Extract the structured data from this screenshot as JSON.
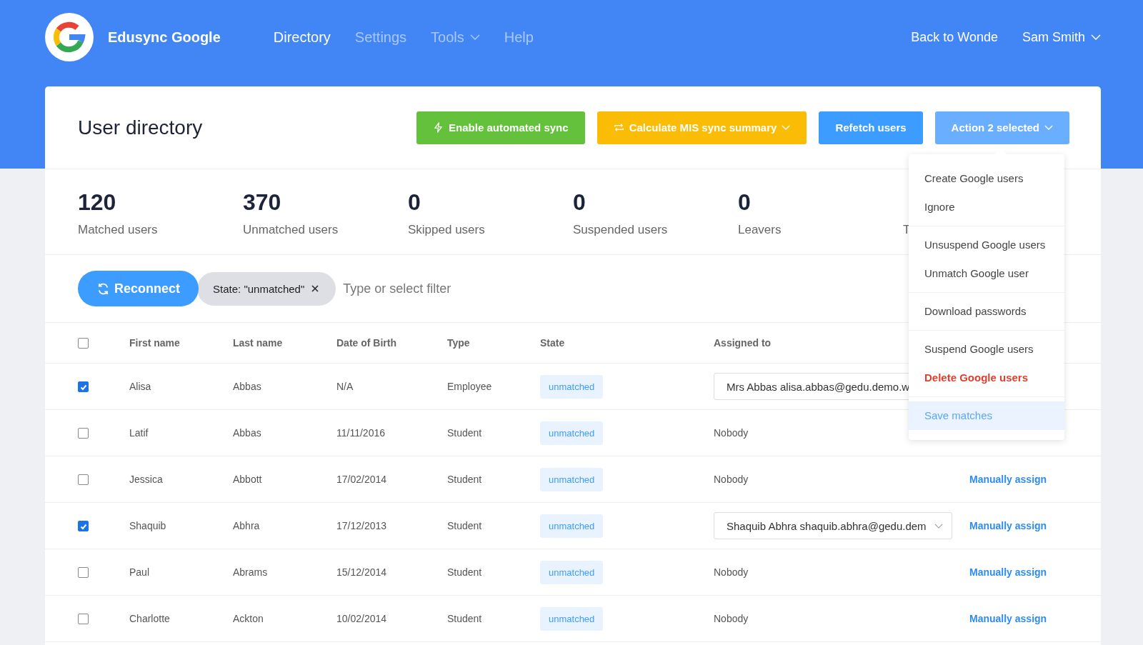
{
  "app": {
    "name": "Edusync Google"
  },
  "nav": [
    {
      "label": "Directory",
      "selected": true,
      "has_menu": false
    },
    {
      "label": "Settings",
      "selected": false,
      "has_menu": false
    },
    {
      "label": "Tools",
      "selected": false,
      "has_menu": true
    },
    {
      "label": "Help",
      "selected": false,
      "has_menu": false
    }
  ],
  "header_links": [
    {
      "label": "Back to Wonde",
      "has_menu": false
    },
    {
      "label": "Sam Smith",
      "has_menu": true
    }
  ],
  "page_title": "User directory",
  "actions": [
    {
      "label": "Enable automated sync",
      "kind": "green",
      "has_menu": false
    },
    {
      "label": "Calculate MIS sync summary",
      "kind": "yellow",
      "has_menu": true
    },
    {
      "label": "Refetch users",
      "kind": "blue",
      "has_menu": false
    },
    {
      "label": "Action 2 selected",
      "kind": "light",
      "has_menu": true
    }
  ],
  "stats": [
    {
      "value": "120",
      "label": "Matched users"
    },
    {
      "value": "370",
      "label": "Unmatched users"
    },
    {
      "value": "0",
      "label": "Skipped users"
    },
    {
      "value": "0",
      "label": "Suspended users"
    },
    {
      "value": "0",
      "label": "Leavers"
    },
    {
      "label": "T"
    }
  ],
  "reconnect": "Reconnect",
  "filter_chips": [
    "State: \"unmatched\""
  ],
  "filter_placeholder": "Type or select filter",
  "table": {
    "select_all_checked": false,
    "columns": [
      "First name",
      "Last name",
      "Date of Birth",
      "Type",
      "State",
      "Assigned to"
    ],
    "rows": [
      {
        "checked": true,
        "first": "Alisa",
        "last": "Abbas",
        "dob": "N/A",
        "type": "Employee",
        "state": "unmatched",
        "assigned": {
          "kind": "select",
          "text": "Mrs Abbas alisa.abbas@gedu.demo.w"
        }
      },
      {
        "checked": false,
        "first": "Latif",
        "last": "Abbas",
        "dob": "11/11/2016",
        "type": "Student",
        "state": "unmatched",
        "assigned": {
          "kind": "text",
          "text": "Nobody"
        }
      },
      {
        "checked": false,
        "first": "Jessica",
        "last": "Abbott",
        "dob": "17/02/2014",
        "type": "Student",
        "state": "unmatched",
        "assigned": {
          "kind": "text",
          "text": "Nobody"
        },
        "action": "Manually assign"
      },
      {
        "checked": true,
        "first": "Shaquib",
        "last": "Abhra",
        "dob": "17/12/2013",
        "type": "Student",
        "state": "unmatched",
        "assigned": {
          "kind": "select",
          "text": "Shaquib Abhra shaquib.abhra@gedu.dem",
          "caret": true
        },
        "action": "Manually assign"
      },
      {
        "checked": false,
        "first": "Paul",
        "last": "Abrams",
        "dob": "15/12/2014",
        "type": "Student",
        "state": "unmatched",
        "assigned": {
          "kind": "text",
          "text": "Nobody"
        },
        "action": "Manually assign"
      },
      {
        "checked": false,
        "first": "Charlotte",
        "last": "Ackton",
        "dob": "10/02/2014",
        "type": "Student",
        "state": "unmatched",
        "assigned": {
          "kind": "text",
          "text": "Nobody"
        },
        "action": "Manually assign"
      }
    ]
  },
  "action_menu": [
    [
      {
        "label": "Create Google users",
        "kind": "normal",
        "selected": false
      },
      {
        "label": "Ignore",
        "kind": "normal",
        "selected": false
      }
    ],
    [
      {
        "label": "Unsuspend Google users",
        "kind": "normal",
        "selected": false
      },
      {
        "label": "Unmatch Google user",
        "kind": "normal",
        "selected": false
      }
    ],
    [
      {
        "label": "Download passwords",
        "kind": "normal",
        "selected": false
      }
    ],
    [
      {
        "label": "Suspend Google users",
        "kind": "normal",
        "selected": false
      },
      {
        "label": "Delete Google users",
        "kind": "danger",
        "selected": false
      }
    ],
    [
      {
        "label": "Save matches",
        "kind": "normal",
        "selected": true
      }
    ]
  ]
}
